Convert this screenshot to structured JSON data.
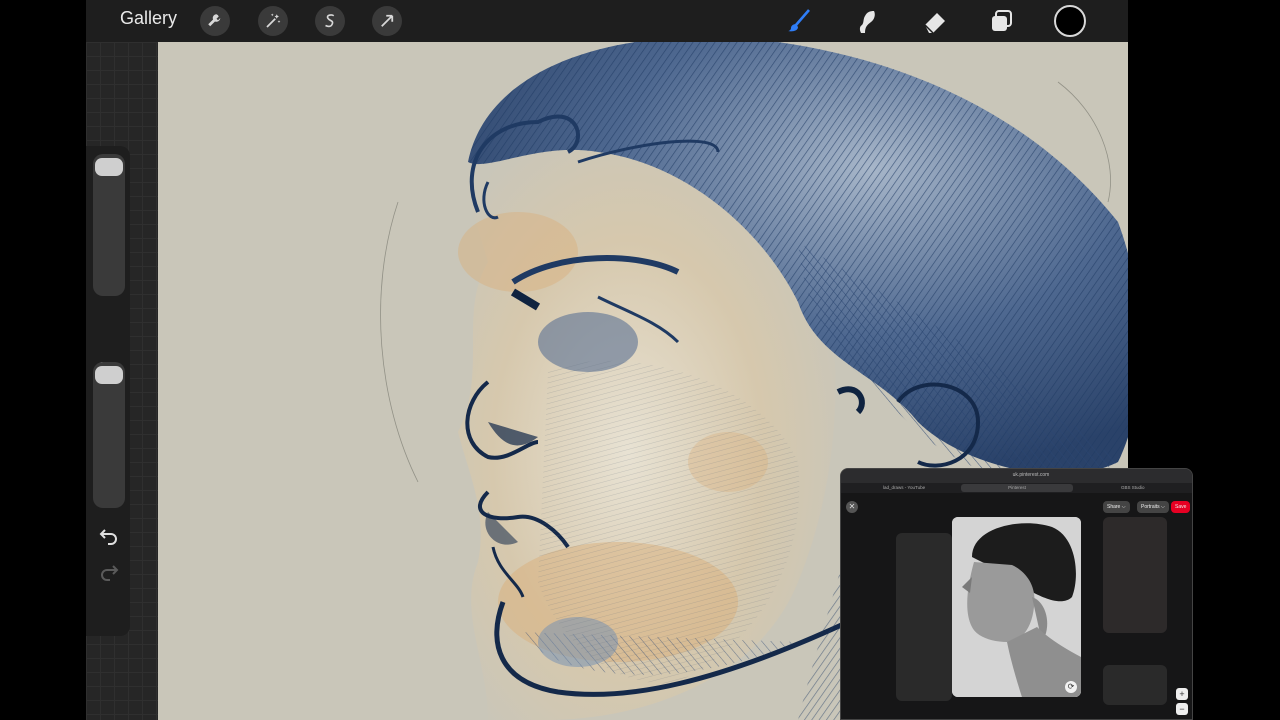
{
  "toolbar": {
    "gallery_label": "Gallery",
    "actions_icon": "wrench-icon",
    "adjustments_icon": "magic-wand-icon",
    "selection_icon": "selection-s-icon",
    "transform_icon": "arrow-cursor-icon",
    "brush_icon": "brush-icon",
    "smudge_icon": "smudge-icon",
    "eraser_icon": "eraser-icon",
    "layers_icon": "layers-icon",
    "current_color": "#000000",
    "accent_color": "#2f7df6"
  },
  "sidebar": {
    "brush_size_icon": "slider",
    "modify_icon": "square-icon",
    "undo_icon": "undo-arrow-icon",
    "redo_icon": "redo-arrow-icon"
  },
  "floating_window": {
    "url": "uk.pinterest.com",
    "tabs": [
      "lad_draws - YouTube",
      "Pinterest",
      "GBS Studio"
    ],
    "buttons": {
      "share": "Share ⌵",
      "board": "Portraits ⌵",
      "save": "Save"
    },
    "zoom_in": "+",
    "zoom_out": "−"
  },
  "colors": {
    "canvas_paper": "#c9c6b9",
    "ink_blue": "#243f66",
    "skin_warm": "#d9b07c"
  }
}
